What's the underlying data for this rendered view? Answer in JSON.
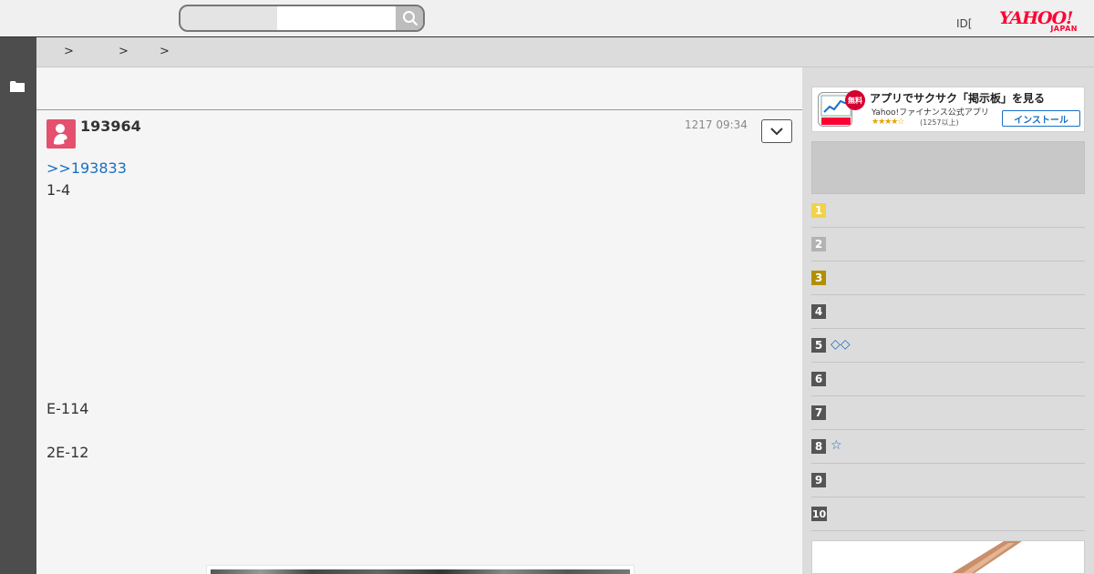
{
  "header": {
    "search": {
      "value": "",
      "placeholder": ""
    },
    "id_link": "ID[",
    "logo": {
      "wordmark": "YAHOO!",
      "sub": "JAPAN"
    }
  },
  "breadcrumb": {
    "separators": [
      ">",
      ">",
      ">"
    ]
  },
  "post": {
    "number": "193964",
    "time": "1217 09:34",
    "reply_to": ">>193833",
    "lines": [
      "1-4",
      "E-114",
      "2E-12"
    ]
  },
  "side": {
    "app_banner": {
      "badge": "無料",
      "title": "アプリでサクサク「掲示板」を見る",
      "subtitle": "Yahoo!ファイナンス公式アプリ",
      "stars": "★★★★☆",
      "reviews": "(1257以上)",
      "install_label": "インストール"
    },
    "ranking": [
      {
        "rank": "1",
        "text": "",
        "color": "#f2d14b"
      },
      {
        "rank": "2",
        "text": "",
        "color": "#b3b3b3"
      },
      {
        "rank": "3",
        "text": "",
        "color": "#b38f00"
      },
      {
        "rank": "4",
        "text": "",
        "color": "#555555"
      },
      {
        "rank": "5",
        "text": "◇◇",
        "color": "#555555"
      },
      {
        "rank": "6",
        "text": "",
        "color": "#555555"
      },
      {
        "rank": "7",
        "text": "",
        "color": "#555555"
      },
      {
        "rank": "8",
        "text": "☆",
        "color": "#555555"
      },
      {
        "rank": "9",
        "text": "",
        "color": "#555555"
      },
      {
        "rank": "10",
        "text": "",
        "color": "#555555"
      }
    ]
  },
  "colors": {
    "accent_link": "#1a6fc4",
    "brand_red": "#ff0033",
    "rail": "#4d4d4d"
  },
  "icons": {
    "search": "search-icon",
    "folder": "folder-icon",
    "menu": "chevron-down-icon",
    "avatar": "avatar-icon"
  }
}
